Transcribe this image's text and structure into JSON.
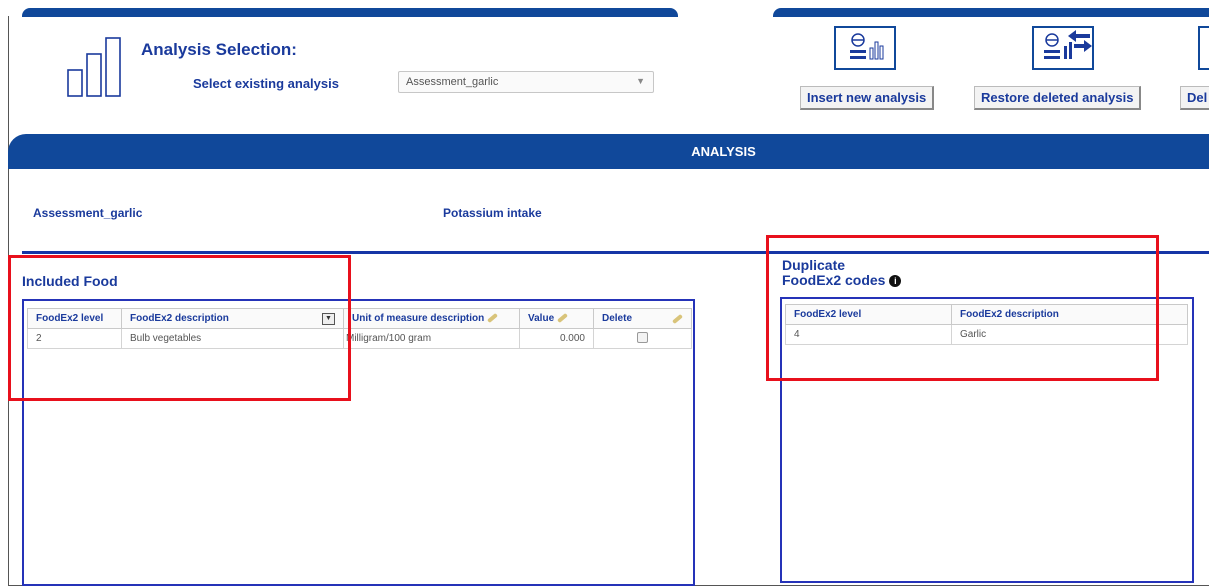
{
  "header": {
    "title": "Analysis Selection:",
    "select_label": "Select existing analysis",
    "select_value": "Assessment_garlic"
  },
  "toolbar": {
    "insert_label": "Insert new analysis",
    "restore_label": "Restore deleted analysis",
    "delete_partial_label": "Del"
  },
  "band": {
    "title": "ANALYSIS"
  },
  "analysis_info": {
    "name": "Assessment_garlic",
    "description": "Potassium intake"
  },
  "included_food": {
    "title": "Included Food",
    "columns": [
      "FoodEx2 level",
      "FoodEx2 description",
      "Unit of measure description",
      "Value",
      "Delete"
    ],
    "rows": [
      {
        "level": "2",
        "description": "Bulb vegetables",
        "unit": "Milligram/100 gram",
        "value": "0.000"
      }
    ]
  },
  "duplicates": {
    "title_line1": "Duplicate",
    "title_line2": "FoodEx2 codes",
    "columns": [
      "FoodEx2 level",
      "FoodEx2 description"
    ],
    "rows": [
      {
        "level": "4",
        "description": "Garlic"
      }
    ]
  },
  "colors": {
    "brand_blue": "#10489a",
    "text_blue": "#1a3a9c",
    "highlight_red": "#e8101c"
  }
}
